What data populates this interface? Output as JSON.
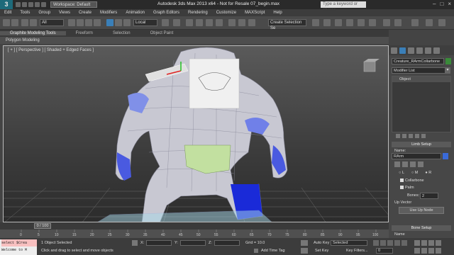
{
  "titlebar": {
    "logo": "3",
    "workspace": "Workspace: Default",
    "title": "Autodesk 3ds Max 2013 x64 - Not for Resale   07_begin.max",
    "search_placeholder": "Type a keyword or phrase"
  },
  "menu": [
    "Edit",
    "Tools",
    "Group",
    "Views",
    "Create",
    "Modifiers",
    "Animation",
    "Graph Editors",
    "Rendering",
    "Customize",
    "MAXScript",
    "Help"
  ],
  "toolbar": {
    "filter_value": "All",
    "coord_value": "Local",
    "selection_set": "Create Selection Se"
  },
  "ribbon": {
    "tabs": [
      "Graphite Modeling Tools",
      "Freeform",
      "Selection",
      "Object Paint"
    ],
    "subpanel": "Polygon Modeling"
  },
  "viewport": {
    "label": "[ + ] [ Perspective ] [ Shaded + Edged Faces ]"
  },
  "command_panel": {
    "object_name": "Creature_RArmCollarbone",
    "modifier_list": "Modifier List",
    "stack_item": "Object",
    "rollout_limb": "Limb Setup",
    "name_label": "Name:",
    "name_value": "RArm",
    "side_labels": [
      "L",
      "M",
      "R"
    ],
    "collarbone_label": "Collarbone",
    "palm_label": "Palm",
    "bones_label": "Bones:",
    "bones_value": "2",
    "up_vector_label": "Up Vector",
    "up_node_button": "Use Up Node",
    "rollout_bone": "Bone Setup",
    "bone_sub": "Name"
  },
  "timeline": {
    "position": "0 / 100",
    "ticks": [
      "0",
      "5",
      "10",
      "15",
      "20",
      "25",
      "30",
      "35",
      "40",
      "45",
      "50",
      "55",
      "60",
      "65",
      "70",
      "75",
      "80",
      "85",
      "90",
      "95",
      "100"
    ]
  },
  "status": {
    "selected": "1 Object Selected",
    "prompt": "Click and drag to select and move objects",
    "x_label": "X:",
    "y_label": "Y:",
    "z_label": "Z:",
    "grid": "Grid = 10.0",
    "add_time_tag": "Add Time Tag",
    "auto_key": "Auto Key",
    "set_key": "Set Key",
    "key_value": "Selected",
    "key_filters": "Key Filters...",
    "frame": "0"
  },
  "maxscript": {
    "line1": "select $Crea",
    "line2": "Welcome to M"
  }
}
